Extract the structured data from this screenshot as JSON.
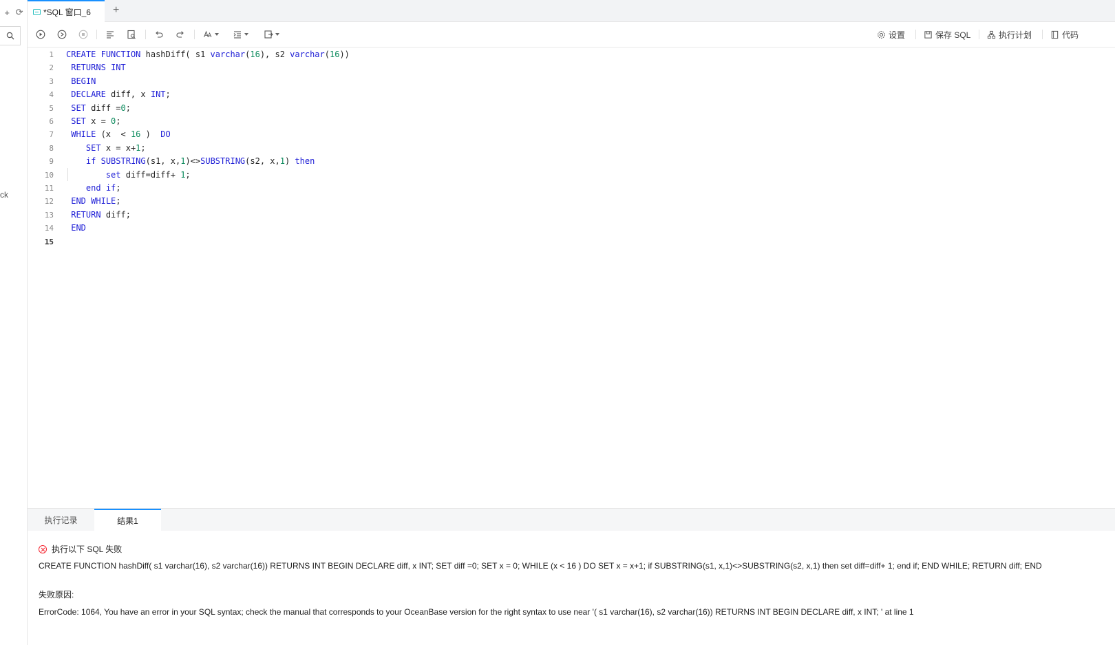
{
  "rail": {
    "plus": "+",
    "refresh": "⟳",
    "cut_text": "ck"
  },
  "tabs": {
    "active_label": "*SQL 窗口_6",
    "add": "+"
  },
  "toolbar": {
    "settings": "设置",
    "save_sql": "保存 SQL",
    "exec_plan": "执行计划",
    "code": "代码"
  },
  "editor": {
    "lines": [
      {
        "n": "1"
      },
      {
        "n": "2"
      },
      {
        "n": "3"
      },
      {
        "n": "4"
      },
      {
        "n": "5"
      },
      {
        "n": "6"
      },
      {
        "n": "7"
      },
      {
        "n": "8"
      },
      {
        "n": "9"
      },
      {
        "n": "10"
      },
      {
        "n": "11"
      },
      {
        "n": "12"
      },
      {
        "n": "13"
      },
      {
        "n": "14"
      },
      {
        "n": "15"
      }
    ],
    "code": [
      [
        [
          "kw",
          "CREATE"
        ],
        [
          "t",
          " "
        ],
        [
          "kw",
          "FUNCTION"
        ],
        [
          "t",
          " hashDiff( s1 "
        ],
        [
          "kw",
          "varchar"
        ],
        [
          "t",
          "("
        ],
        [
          "num",
          "16"
        ],
        [
          "t",
          "), s2 "
        ],
        [
          "kw",
          "varchar"
        ],
        [
          "t",
          "("
        ],
        [
          "num",
          "16"
        ],
        [
          "t",
          "))"
        ]
      ],
      [
        [
          "t",
          " "
        ],
        [
          "kw",
          "RETURNS"
        ],
        [
          "t",
          " "
        ],
        [
          "kw",
          "INT"
        ]
      ],
      [
        [
          "t",
          " "
        ],
        [
          "kw",
          "BEGIN"
        ]
      ],
      [
        [
          "t",
          " "
        ],
        [
          "kw",
          "DECLARE"
        ],
        [
          "t",
          " diff, x "
        ],
        [
          "kw",
          "INT"
        ],
        [
          "t",
          ";"
        ]
      ],
      [
        [
          "t",
          " "
        ],
        [
          "kw",
          "SET"
        ],
        [
          "t",
          " diff ="
        ],
        [
          "num",
          "0"
        ],
        [
          "t",
          ";"
        ]
      ],
      [
        [
          "t",
          " "
        ],
        [
          "kw",
          "SET"
        ],
        [
          "t",
          " x = "
        ],
        [
          "num",
          "0"
        ],
        [
          "t",
          ";"
        ]
      ],
      [
        [
          "t",
          " "
        ],
        [
          "kw",
          "WHILE"
        ],
        [
          "t",
          " (x  < "
        ],
        [
          "num",
          "16"
        ],
        [
          "t",
          " )  "
        ],
        [
          "kw",
          "DO"
        ]
      ],
      [
        [
          "t",
          "    "
        ],
        [
          "kw",
          "SET"
        ],
        [
          "t",
          " x = x+"
        ],
        [
          "num",
          "1"
        ],
        [
          "t",
          ";"
        ]
      ],
      [
        [
          "t",
          "    "
        ],
        [
          "kw",
          "if"
        ],
        [
          "t",
          " "
        ],
        [
          "kw",
          "SUBSTRING"
        ],
        [
          "t",
          "(s1, x,"
        ],
        [
          "num",
          "1"
        ],
        [
          "t",
          ")<>"
        ],
        [
          "kw",
          "SUBSTRING"
        ],
        [
          "t",
          "(s2, x,"
        ],
        [
          "num",
          "1"
        ],
        [
          "t",
          ") "
        ],
        [
          "kw",
          "then"
        ]
      ],
      [
        [
          "t",
          "        "
        ],
        [
          "kw",
          "set"
        ],
        [
          "t",
          " diff=diff+ "
        ],
        [
          "num",
          "1"
        ],
        [
          "t",
          ";"
        ]
      ],
      [
        [
          "t",
          "    "
        ],
        [
          "kw",
          "end"
        ],
        [
          "t",
          " "
        ],
        [
          "kw",
          "if"
        ],
        [
          "t",
          ";"
        ]
      ],
      [
        [
          "t",
          " "
        ],
        [
          "kw",
          "END"
        ],
        [
          "t",
          " "
        ],
        [
          "kw",
          "WHILE"
        ],
        [
          "t",
          ";"
        ]
      ],
      [
        [
          "t",
          " "
        ],
        [
          "kw",
          "RETURN"
        ],
        [
          "t",
          " diff;"
        ]
      ],
      [
        [
          "t",
          " "
        ],
        [
          "kw",
          "END"
        ]
      ],
      []
    ]
  },
  "result": {
    "tabs": [
      "执行记录",
      "结果1"
    ],
    "active_tab": 1,
    "error_title": "执行以下 SQL 失败",
    "sql": "CREATE FUNCTION hashDiff( s1 varchar(16), s2 varchar(16)) RETURNS INT BEGIN DECLARE diff, x INT; SET diff =0; SET x = 0; WHILE (x < 16 ) DO SET x = x+1; if SUBSTRING(s1, x,1)<>SUBSTRING(s2, x,1) then set diff=diff+ 1; end if; END WHILE; RETURN diff; END",
    "reason_label": "失败原因:",
    "reason": "ErrorCode: 1064, You have an error in your SQL syntax; check the manual that corresponds to your OceanBase version for the right syntax to use near '( s1 varchar(16), s2 varchar(16)) RETURNS INT BEGIN DECLARE diff, x INT; ' at line 1"
  },
  "colors": {
    "accent": "#1890ff",
    "keyword": "#1c1cd6",
    "number": "#0b8a5c",
    "error": "#f5222d"
  }
}
